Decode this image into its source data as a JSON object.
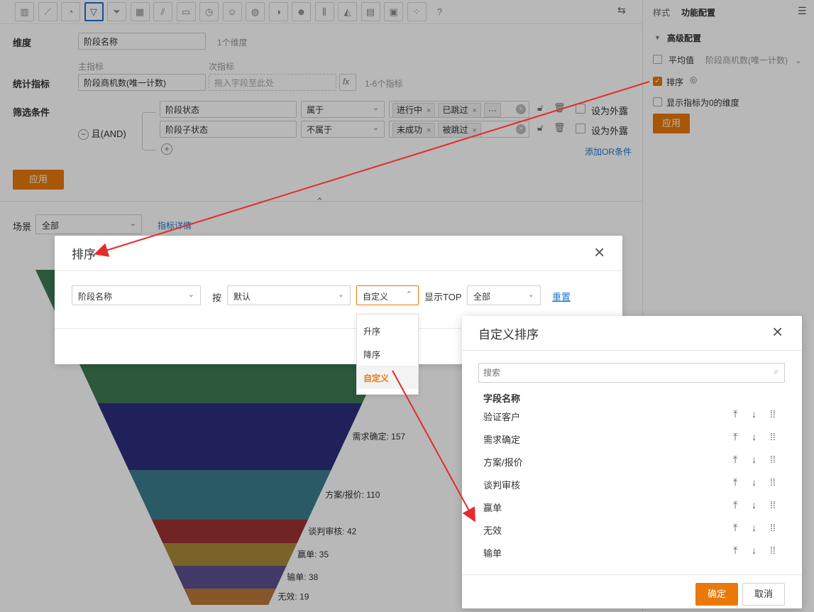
{
  "toolbar": {
    "icons": [
      "bar-chart-icon",
      "line-chart-icon",
      "pie-chart-icon",
      "funnel-icon",
      "funnel-alt-icon",
      "table-icon",
      "combo-chart-icon",
      "card-icon",
      "gauge-icon",
      "map-icon",
      "globe-icon",
      "map-alt-icon",
      "smile-icon",
      "column-icon",
      "area-icon",
      "matrix-icon",
      "pivot-icon",
      "scatter-icon",
      "help-icon"
    ],
    "active_index": 4
  },
  "config": {
    "dimension_label": "维度",
    "dimension_value": "阶段名称",
    "dimension_hint": "1个维度",
    "primary_metric_label": "主指标",
    "secondary_metric_label": "次指标",
    "stat_label": "统计指标",
    "stat_value": "阶段商机数(唯一计数)",
    "secondary_placeholder": "拖入字段至此处",
    "fx_label": "fx",
    "metric_hint": "1-6个指标",
    "filter_label": "筛选条件",
    "and_label": "且(AND)",
    "filters": [
      {
        "field": "阶段状态",
        "op": "属于",
        "tags": [
          "进行中",
          "已跳过"
        ],
        "more": "···",
        "expose": "设为外露"
      },
      {
        "field": "阶段子状态",
        "op": "不属于",
        "tags": [
          "未成功",
          "被跳过"
        ],
        "more": "",
        "expose": "设为外露"
      }
    ],
    "add_or": "添加OR条件",
    "apply": "应用"
  },
  "scene": {
    "label": "场景",
    "value": "全部",
    "detail_link": "指标详情"
  },
  "right_panel": {
    "tab_style": "样式",
    "tab_func": "功能配置",
    "section": "高级配置",
    "avg_label": "平均值",
    "avg_select": "阶段商机数(唯一计数)",
    "sort_label": "排序",
    "zero_label": "显示指标为0的维度",
    "apply": "应用"
  },
  "chart_data": {
    "type": "funnel",
    "categories": [
      "需求确定",
      "方案/报价",
      "谈判审核",
      "赢单",
      "输单",
      "无效"
    ],
    "values": [
      157,
      110,
      42,
      35,
      38,
      19
    ],
    "labels": [
      "需求确定: 157",
      "方案/报价: 110",
      "谈判审核: 42",
      "赢单: 35",
      "输单: 38",
      "无效: 19"
    ],
    "colors": [
      "#2d2d7e",
      "#3b7d8c",
      "#9b3332",
      "#a98a3a",
      "#5a4f8e",
      "#b77838"
    ]
  },
  "sort_modal": {
    "title": "排序",
    "field": "阶段名称",
    "by_label": "按",
    "by_value": "默认",
    "order_value": "自定义",
    "top_label": "显示TOP",
    "top_value": "全部",
    "reset": "重置",
    "options": [
      "升序",
      "降序",
      "自定义"
    ],
    "selected_option": "自定义"
  },
  "custom_modal": {
    "title": "自定义排序",
    "search_placeholder": "搜索",
    "column_header": "字段名称",
    "items": [
      "验证客户",
      "需求确定",
      "方案/报价",
      "谈判审核",
      "赢单",
      "无效",
      "输单"
    ],
    "confirm": "确定",
    "cancel": "取消"
  },
  "colors": {
    "accent": "#e8790a",
    "link": "#1a78d4",
    "arrow": "#e52b2b"
  }
}
